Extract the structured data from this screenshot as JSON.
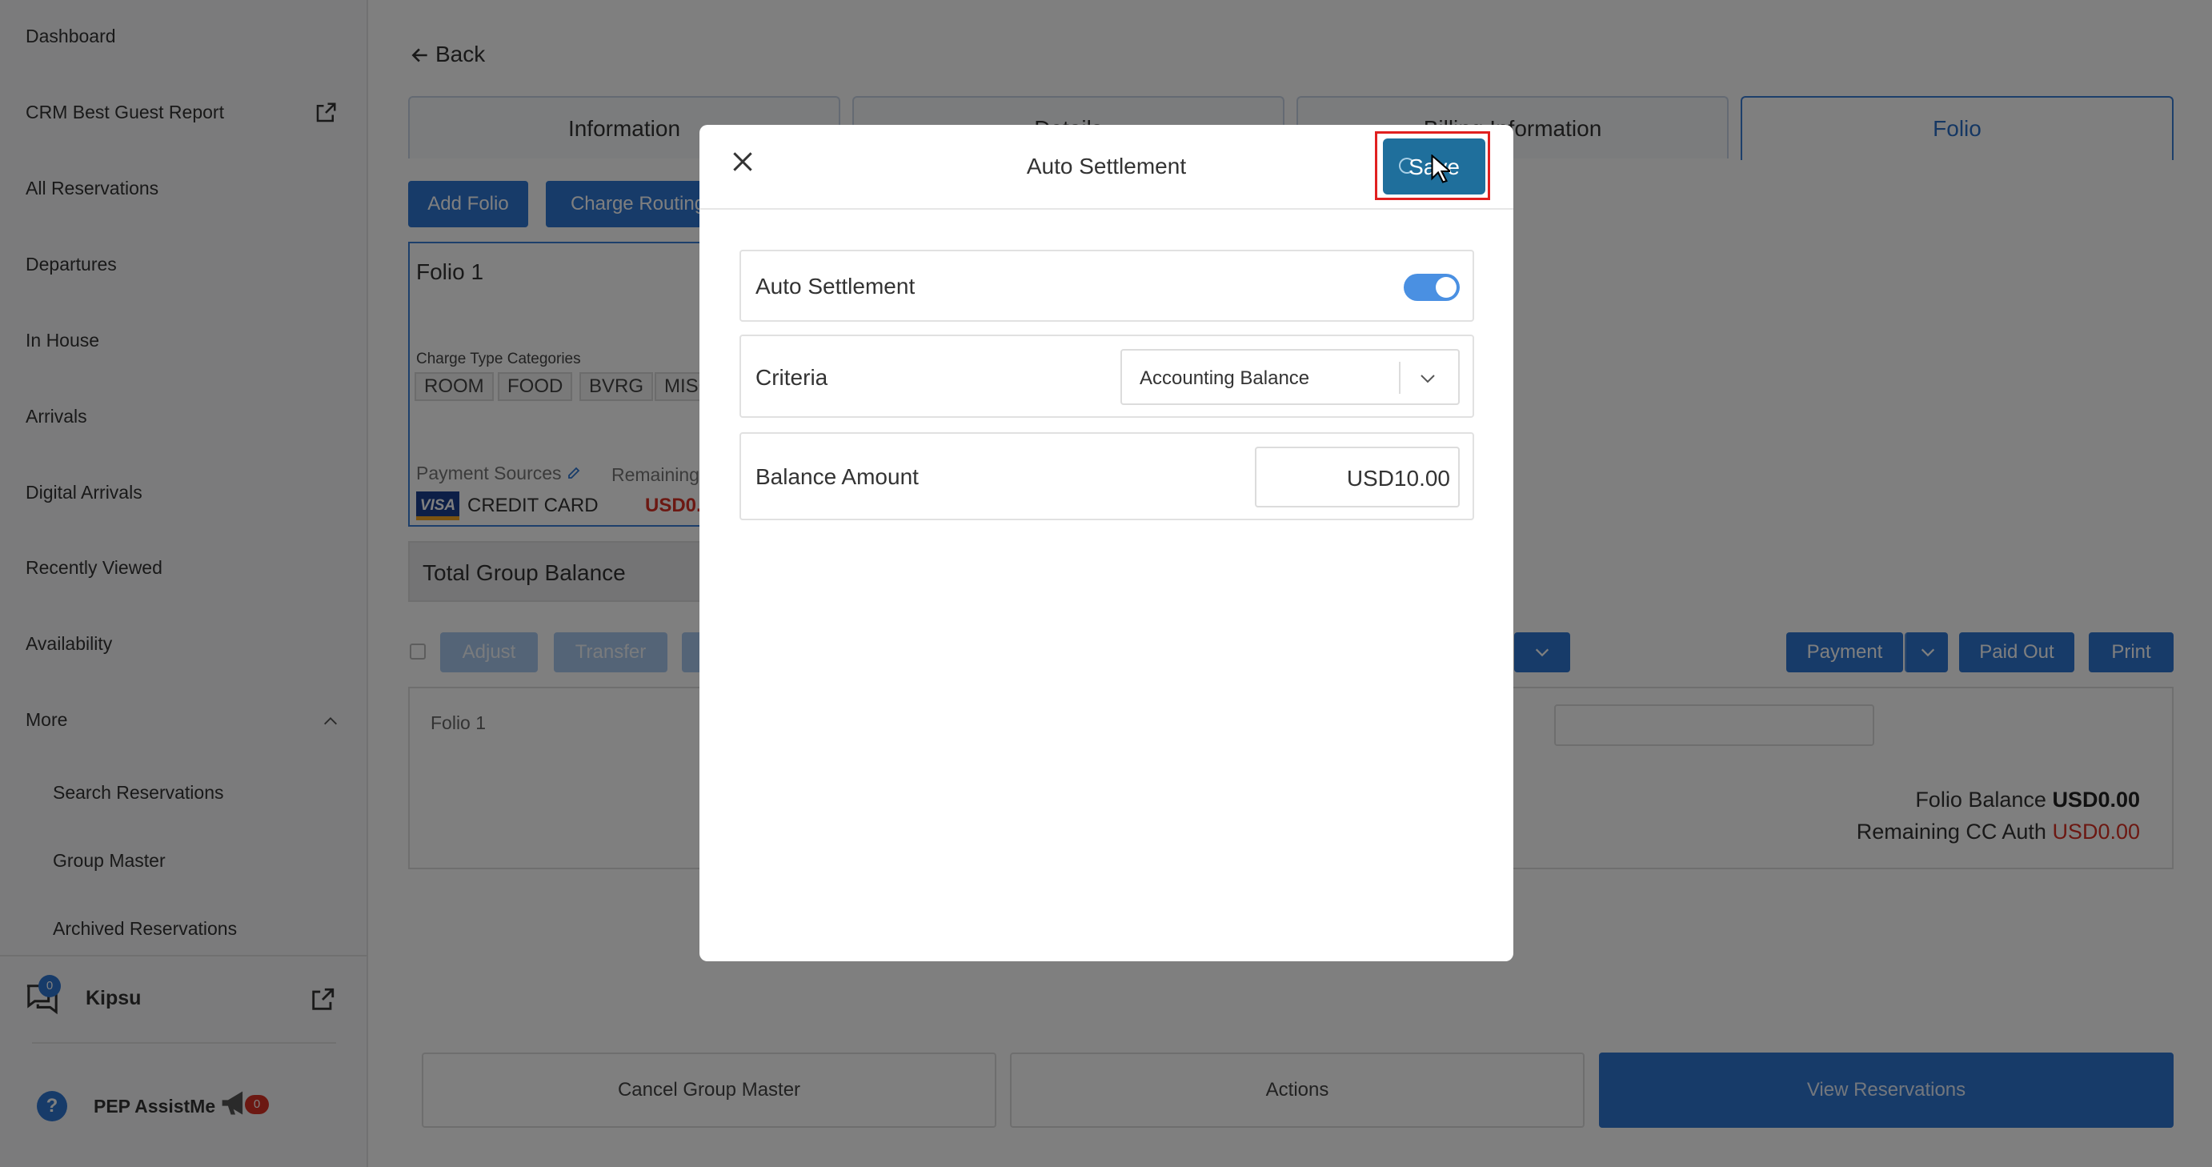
{
  "sidebar": {
    "items": [
      {
        "label": "Dashboard"
      },
      {
        "label": "CRM Best Guest Report"
      },
      {
        "label": "All Reservations"
      },
      {
        "label": "Departures"
      },
      {
        "label": "In House"
      },
      {
        "label": "Arrivals"
      },
      {
        "label": "Digital Arrivals"
      },
      {
        "label": "Recently Viewed"
      },
      {
        "label": "Availability"
      },
      {
        "label": "More"
      }
    ],
    "sub_items": [
      {
        "label": "Search Reservations"
      },
      {
        "label": "Group Master"
      },
      {
        "label": "Archived Reservations"
      }
    ],
    "kipsu": {
      "label": "Kipsu",
      "badge": "0"
    },
    "assist": {
      "label": "PEP AssistMe",
      "badge": "0"
    }
  },
  "main": {
    "back_label": "Back",
    "tabs": [
      {
        "label": "Information"
      },
      {
        "label": "Details"
      },
      {
        "label": "Billing Information"
      },
      {
        "label": "Folio"
      }
    ],
    "add_folio_label": "Add Folio",
    "charge_routing_label": "Charge Routing",
    "folio_card": {
      "title": "Folio 1",
      "categories_label": "Charge Type Categories",
      "categories": [
        "ROOM",
        "FOOD",
        "BVRG",
        "MISC"
      ],
      "payment_sources_label": "Payment Sources",
      "remaining_label": "Remaining",
      "card_brand": "VISA",
      "card_type": "CREDIT CARD",
      "remaining_value": "USD0."
    },
    "total_group_balance_label": "Total Group Balance",
    "actions": {
      "adjust": "Adjust",
      "transfer": "Transfer",
      "payment": "Payment",
      "paid_out": "Paid Out",
      "print": "Print"
    },
    "folio_panel": {
      "title": "Folio 1",
      "folio_balance_label": "Folio Balance",
      "folio_balance_value": "USD0.00",
      "remaining_cc_label": "Remaining CC Auth",
      "remaining_cc_value": "USD0.00"
    },
    "bottom": {
      "cancel": "Cancel Group Master",
      "actions": "Actions",
      "view": "View Reservations"
    }
  },
  "modal": {
    "title": "Auto Settlement",
    "save_label": "Save",
    "auto_settlement_label": "Auto Settlement",
    "auto_settlement_on": true,
    "criteria_label": "Criteria",
    "criteria_value": "Accounting Balance",
    "balance_amount_label": "Balance Amount",
    "balance_amount_value": "USD10.00"
  },
  "colors": {
    "primary": "#2f76d2",
    "save_button": "#1f6f9c",
    "highlight": "#e02020",
    "negative": "#d93025",
    "toggle": "#4a90e2"
  }
}
